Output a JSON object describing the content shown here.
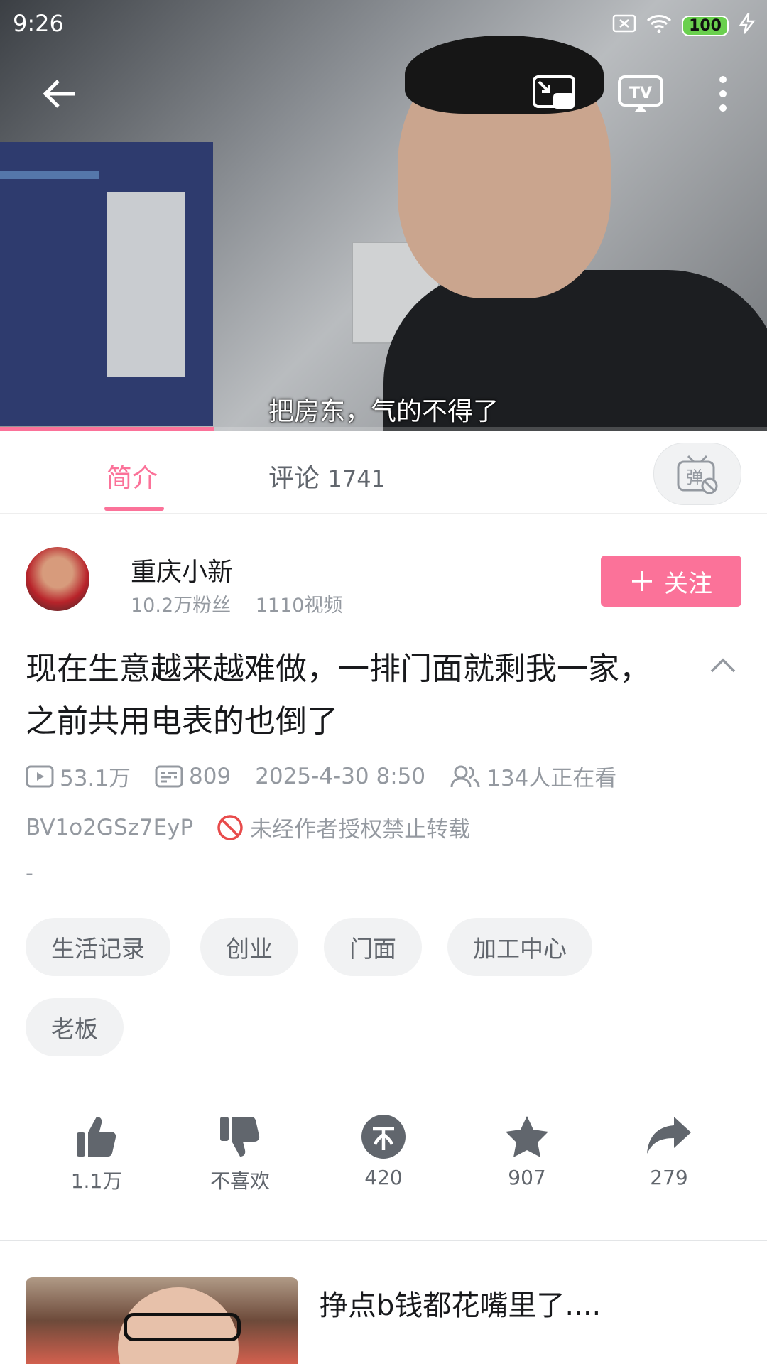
{
  "status_bar": {
    "time": "9:26",
    "battery": "100"
  },
  "video": {
    "subtitle": "把房东，气的不得了",
    "progress_fraction": 0.28
  },
  "tabs": {
    "intro": "简介",
    "comments_label": "评论",
    "comments_count": "1741",
    "danmaku_icon_text": "弹"
  },
  "author": {
    "name": "重庆小新",
    "fans": "10.2万粉丝",
    "videos": "1110视频",
    "follow_label": "关注"
  },
  "video_info": {
    "title": "现在生意越来越难做，一排门面就剩我一家，之前共用电表的也倒了",
    "views": "53.1万",
    "danmaku": "809",
    "date": "2025-4-30 8:50",
    "watching": "134人正在看",
    "bvid": "BV1o2GSz7EyP",
    "copyright": "未经作者授权禁止转载",
    "desc": "-"
  },
  "tags": [
    "生活记录",
    "创业",
    "门面",
    "加工中心",
    "老板"
  ],
  "actions": {
    "like": "1.1万",
    "dislike": "不喜欢",
    "coin": "420",
    "favorite": "907",
    "share": "279"
  },
  "recommend": {
    "title": "挣点b钱都花嘴里了...."
  },
  "colors": {
    "accent": "#fb7299",
    "text_secondary": "#9499a0"
  }
}
